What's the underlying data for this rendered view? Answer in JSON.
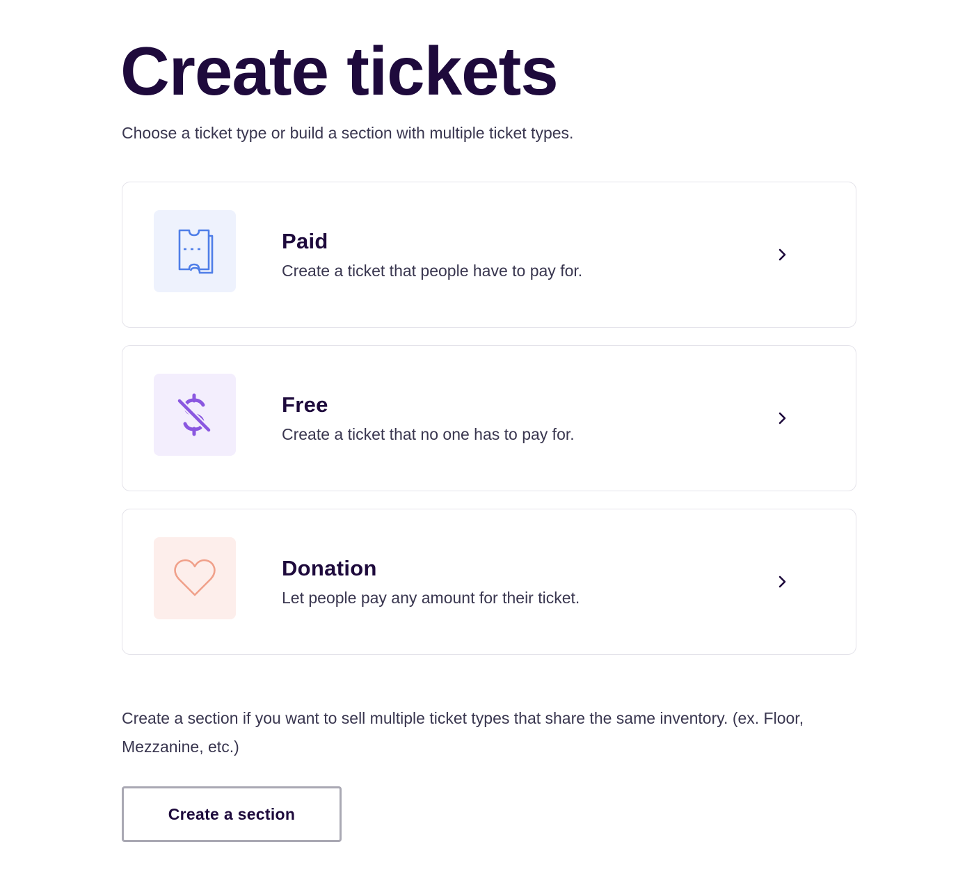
{
  "header": {
    "title": "Create tickets",
    "subtitle": "Choose a ticket type or build a section with multiple ticket types."
  },
  "ticket_types": [
    {
      "title": "Paid",
      "description": "Create a ticket that people have to pay for.",
      "icon": "ticket-icon",
      "icon_color": "#4f7ee8",
      "icon_bg": "#eef2fd"
    },
    {
      "title": "Free",
      "description": "Create a ticket that no one has to pay for.",
      "icon": "no-dollar-icon",
      "icon_color": "#8a57e0",
      "icon_bg": "#f3eefd"
    },
    {
      "title": "Donation",
      "description": "Let people pay any amount for their ticket.",
      "icon": "heart-icon",
      "icon_color": "#f0a08a",
      "icon_bg": "#fdeeeb"
    }
  ],
  "section": {
    "note": "Create a section if you want to sell multiple ticket types that share the same inventory. (ex. Floor, Mezzanine, etc.)",
    "button_label": "Create a section"
  },
  "colors": {
    "text_primary": "#1e0a3c",
    "text_secondary": "#39364f",
    "card_border": "#e4e3ea",
    "button_border": "#a9a8b3"
  }
}
